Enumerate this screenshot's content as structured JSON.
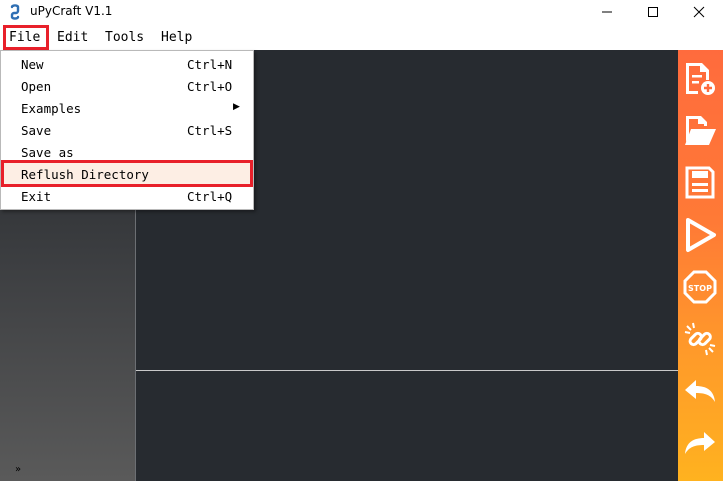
{
  "window": {
    "title": "uPyCraft V1.1",
    "controls": [
      "minimize-icon",
      "maximize-icon",
      "close-icon"
    ]
  },
  "menubar": {
    "items": [
      {
        "label": "File"
      },
      {
        "label": "Edit"
      },
      {
        "label": "Tools"
      },
      {
        "label": "Help"
      }
    ]
  },
  "file_menu": {
    "items": [
      {
        "label": "New",
        "shortcut": "Ctrl+N"
      },
      {
        "label": "Open",
        "shortcut": "Ctrl+O"
      },
      {
        "label": "Examples",
        "submenu_icon": "chevron-right-icon"
      },
      {
        "label": "Save",
        "shortcut": "Ctrl+S"
      },
      {
        "label": "Save as"
      },
      {
        "label": "Reflush Directory",
        "highlighted": true
      },
      {
        "label": "Exit",
        "shortcut": "Ctrl+Q"
      }
    ]
  },
  "toolbar": {
    "icons": [
      "new-file-icon",
      "open-folder-icon",
      "save-icon",
      "run-icon",
      "stop-icon",
      "connect-icon",
      "undo-icon",
      "redo-icon"
    ],
    "more_icon": "»"
  },
  "colors": {
    "workspace": "#272b30",
    "toolbar_top": "#ff6b3d",
    "toolbar_bottom": "#ffb21f",
    "highlight_box": "#e8202a"
  }
}
